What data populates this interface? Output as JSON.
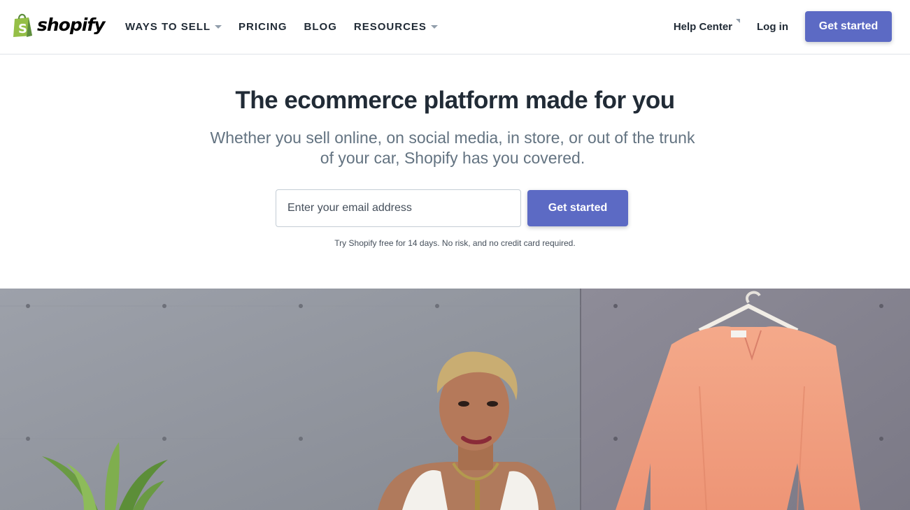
{
  "brand": {
    "name": "shopify",
    "accent_color": "#5c6ac4",
    "logo_green": "#95bf47"
  },
  "nav": {
    "items": [
      {
        "label": "WAYS TO SELL",
        "has_dropdown": true
      },
      {
        "label": "PRICING",
        "has_dropdown": false
      },
      {
        "label": "BLOG",
        "has_dropdown": false
      },
      {
        "label": "RESOURCES",
        "has_dropdown": true
      }
    ]
  },
  "header_right": {
    "help_center": "Help Center",
    "login": "Log in",
    "cta": "Get started"
  },
  "hero": {
    "title": "The ecommerce platform made for you",
    "subtitle": "Whether you sell online, on social media, in store, or out of the trunk of your car, Shopify has you covered.",
    "email_placeholder": "Enter your email address",
    "email_value": "",
    "cta": "Get started",
    "disclaimer": "Try Shopify free for 14 days. No risk, and no credit card required."
  },
  "hero_image": {
    "subjects": [
      "concrete-wall",
      "woman-with-blonde-hair",
      "peach-blouse-on-hanger",
      "potted-plant"
    ]
  }
}
